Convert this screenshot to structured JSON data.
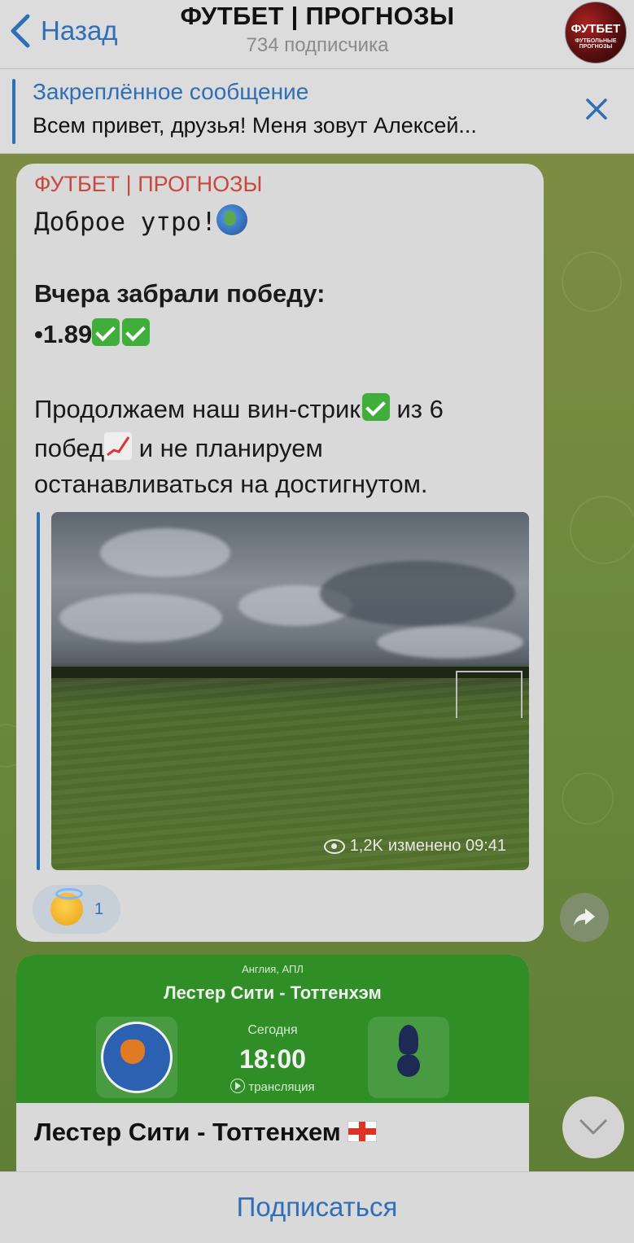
{
  "header": {
    "back_label": "Назад",
    "title": "ФУТБЕТ | ПРОГНОЗЫ",
    "subtitle": "734 подписчика",
    "avatar_text": "ФУТБЕТ",
    "avatar_sub": "ФУТБОЛЬНЫЕ ПРОГНОЗЫ"
  },
  "pinned": {
    "title": "Закреплённое сообщение",
    "text": "Всем привет, друзья! Меня зовут Алексей..."
  },
  "message": {
    "author": "ФУТБЕТ | ПРОГНОЗЫ",
    "greeting": "Доброе утро!",
    "heading": "Вчера забрали победу:",
    "odds": "•1.89",
    "body_part1": "Продолжаем наш вин-стрик",
    "body_part2": " из 6",
    "body_line2a": "побед",
    "body_line2b": " и не планируем",
    "body_line3": "останавливаться на достигнутом.",
    "views": "1,2K",
    "edited": "изменено 09:41",
    "reaction_count": "1",
    "icons": [
      "globe-icon",
      "check-icon",
      "chart-increasing-icon",
      "eye-icon",
      "angel-emoji-icon",
      "share-icon"
    ]
  },
  "match_card": {
    "league": "Англия, АПЛ",
    "title": "Лестер Сити - Тоттенхэм",
    "day": "Сегодня",
    "time": "18:00",
    "stream": "трансляция",
    "heading": "Лестер Сити - Тоттенхем"
  },
  "footer": {
    "subscribe_label": "Подписаться"
  },
  "colors": {
    "accent": "#2f6fb8",
    "author": "#c8483e",
    "card_green": "#2f8e26"
  }
}
